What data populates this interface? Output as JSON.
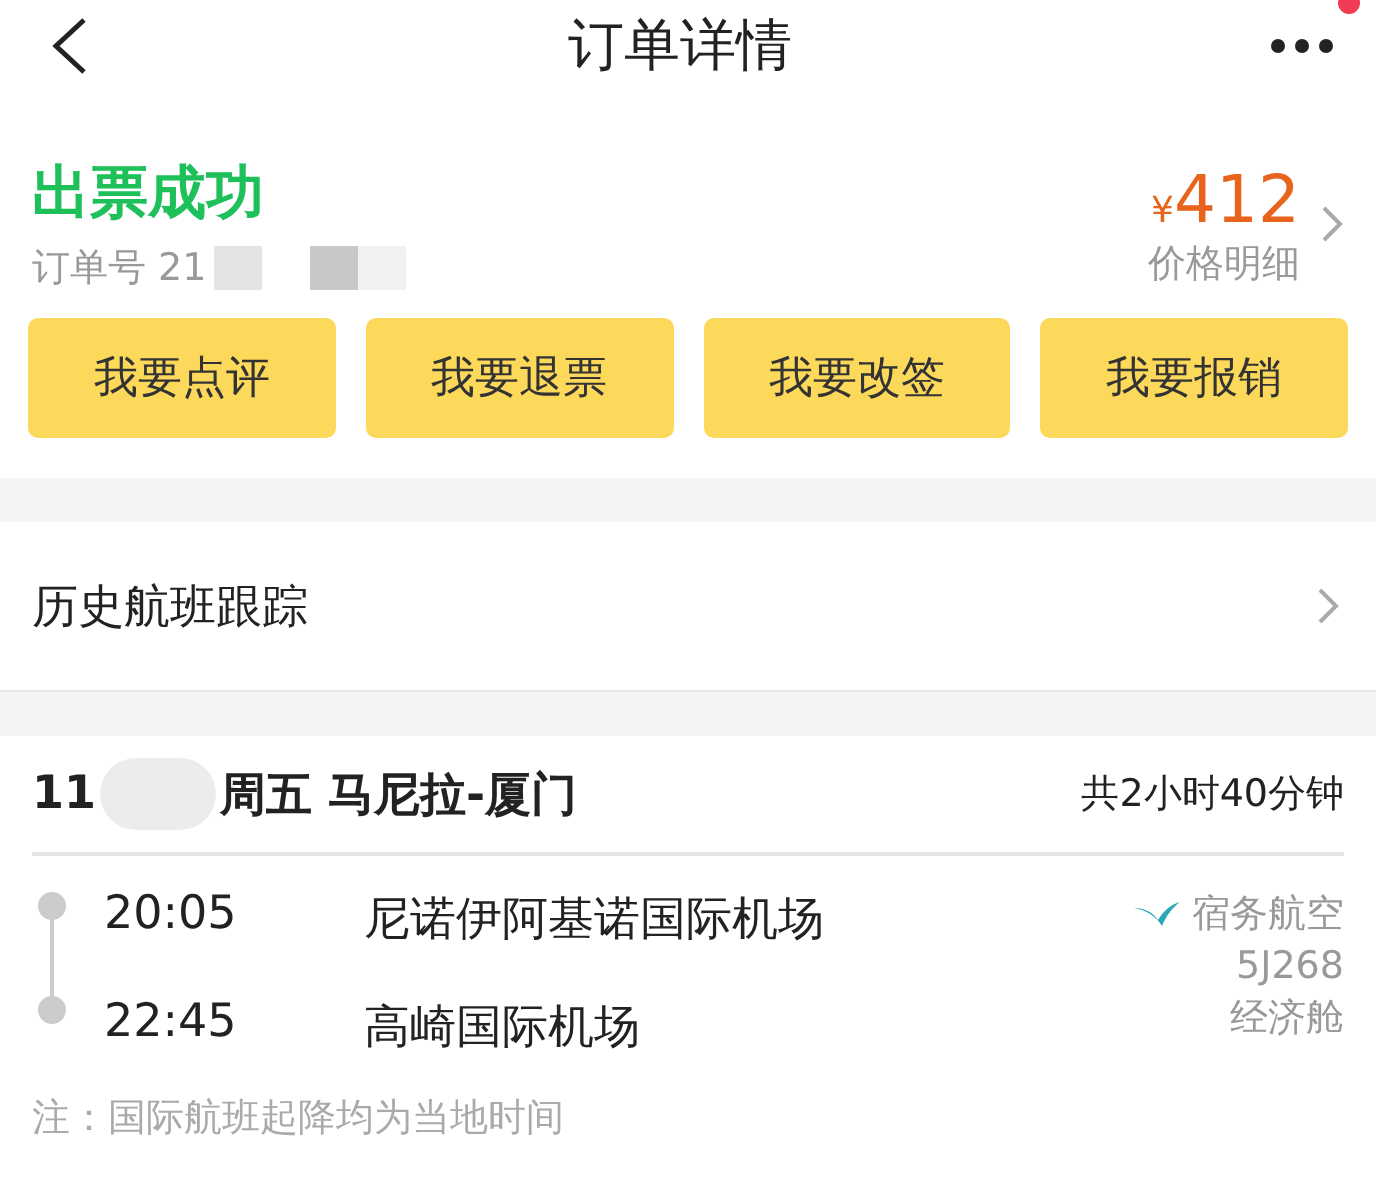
{
  "header": {
    "title": "订单详情",
    "notification": true
  },
  "order": {
    "status": "出票成功",
    "order_number": "订单号 21",
    "currency": "¥",
    "price": "412",
    "price_link": "价格明细"
  },
  "actions": [
    {
      "label": "我要点评"
    },
    {
      "label": "我要退票"
    },
    {
      "label": "我要改签"
    },
    {
      "label": "我要报销"
    }
  ],
  "history_link": "历史航班跟踪",
  "flight": {
    "date": "11",
    "route": "周五 马尼拉-厦门",
    "duration": "共2小时40分钟",
    "stops": [
      {
        "time": "20:05",
        "airport": "尼诺伊阿基诺国际机场"
      },
      {
        "time": "22:45",
        "airport": "高崎国际机场"
      }
    ],
    "airline": "宿务航空",
    "flight_number": "5J268",
    "cabin": "经济舱",
    "note": "注：国际航班起降均为当地时间"
  }
}
